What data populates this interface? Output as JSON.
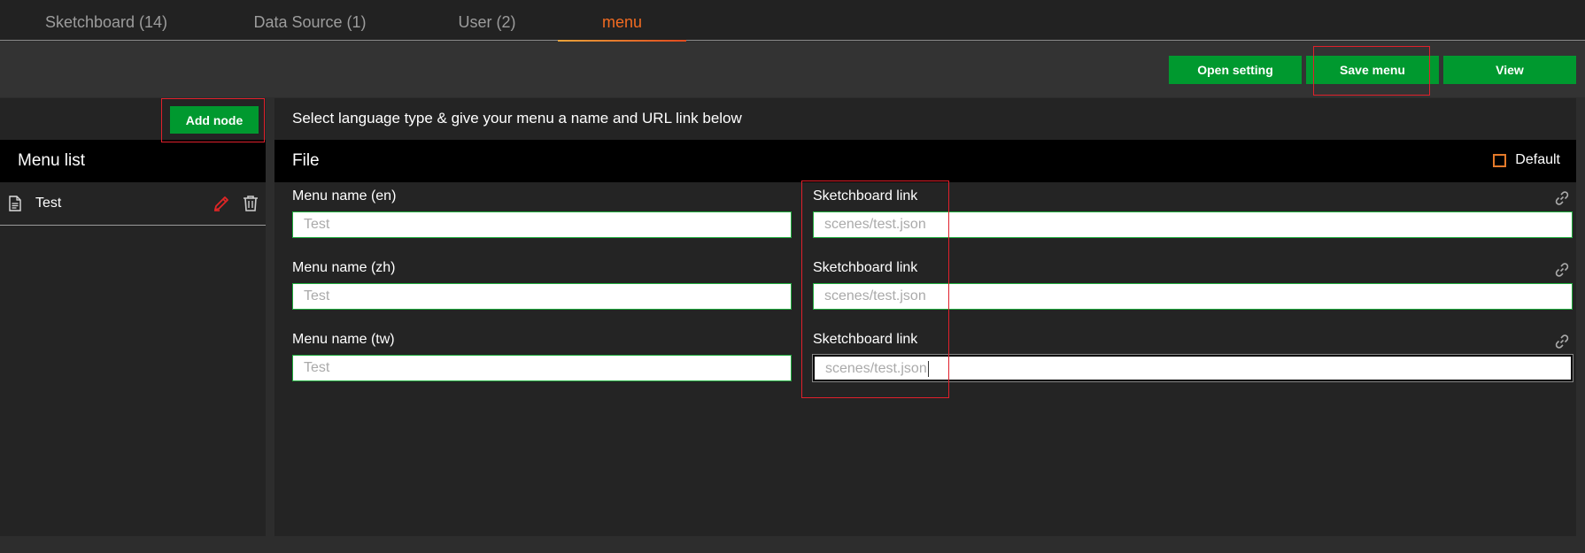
{
  "tabs": [
    {
      "label": "Sketchboard (14)"
    },
    {
      "label": "Data Source (1)"
    },
    {
      "label": "User (2)"
    },
    {
      "label": "menu"
    }
  ],
  "toolbar": {
    "open_setting": "Open setting",
    "save_menu": "Save menu",
    "view": "View"
  },
  "left": {
    "add_node": "Add node",
    "menu_list_title": "Menu list",
    "items": [
      {
        "label": "Test"
      }
    ]
  },
  "right": {
    "instruction": "Select language type & give your menu a name and URL link below",
    "file_title": "File",
    "default_label": "Default",
    "rows": [
      {
        "name_label": "Menu name (en)",
        "name_value": "Test",
        "link_label": "Sketchboard link",
        "link_value": "scenes/test.json"
      },
      {
        "name_label": "Menu name (zh)",
        "name_value": "Test",
        "link_label": "Sketchboard link",
        "link_value": "scenes/test.json"
      },
      {
        "name_label": "Menu name (tw)",
        "name_value": "Test",
        "link_label": "Sketchboard link",
        "link_value": "scenes/test.json"
      }
    ]
  },
  "colors": {
    "accent_orange": "#f26b21",
    "button_green": "#00992f",
    "highlight_red": "#e0202b",
    "input_border_green": "#1eab3c"
  }
}
